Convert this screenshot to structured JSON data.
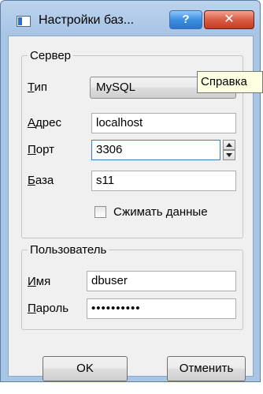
{
  "window": {
    "title": "Настройки баз...",
    "help_label": "?",
    "close_label": "✕"
  },
  "server_group": {
    "title": "Сервер",
    "type": {
      "label_mnemonic": "Т",
      "label_rest": "ип",
      "value": "MySQL"
    },
    "address": {
      "label_mnemonic": "А",
      "label_rest": "дрес",
      "value": "localhost"
    },
    "port": {
      "label_mnemonic": "П",
      "label_rest": "орт",
      "value": "3306"
    },
    "database": {
      "label_mnemonic": "Б",
      "label_rest": "аза",
      "value": "s11"
    },
    "compress": {
      "label": "Сжимать данные",
      "checked": false
    }
  },
  "user_group": {
    "title": "Пользователь",
    "name": {
      "label_mnemonic": "И",
      "label_rest": "мя",
      "value": "dbuser"
    },
    "password": {
      "label_mnemonic": "П",
      "label_rest": "ароль",
      "value": "••••••••••"
    }
  },
  "buttons": {
    "ok": "OK",
    "cancel": "Отменить"
  },
  "tooltip": {
    "text": "Справка"
  },
  "colors": {
    "titlebar": "#a9c5e6",
    "close_button": "#d95d44",
    "help_button": "#3d8fe0",
    "client_area": "#f0f0f0",
    "tooltip_bg": "#ffffe1"
  }
}
